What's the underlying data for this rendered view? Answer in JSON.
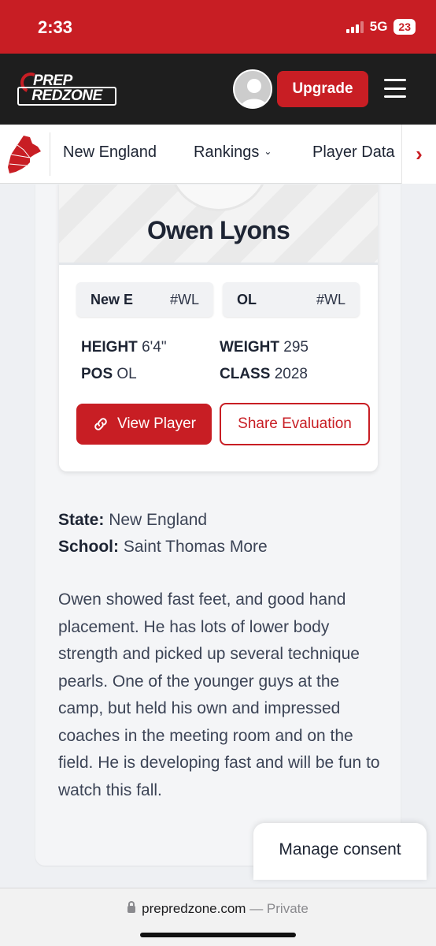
{
  "status": {
    "time": "2:33",
    "network": "5G",
    "battery": "23"
  },
  "header": {
    "logo_line1": "PREP",
    "logo_line2": "REDZONE",
    "upgrade_label": "Upgrade"
  },
  "subnav": {
    "items": [
      "New England",
      "Rankings",
      "Player Data"
    ],
    "next_icon": "chevron-right-icon"
  },
  "player": {
    "name": "Owen Lyons",
    "rank_region": {
      "label": "New E",
      "value": "#WL"
    },
    "rank_position": {
      "label": "OL",
      "value": "#WL"
    },
    "height_label": "HEIGHT",
    "height": "6'4\"",
    "weight_label": "WEIGHT",
    "weight": "295",
    "pos_label": "POS",
    "pos": "OL",
    "class_label": "CLASS",
    "class": "2028",
    "view_label": "View Player",
    "share_label": "Share Evaluation"
  },
  "details": {
    "state_label": "State:",
    "state": "New England",
    "school_label": "School:",
    "school": "Saint Thomas More",
    "evaluation": "Owen showed fast feet, and good hand placement. He has lots of lower body strength and picked up several technique pearls. One of the younger guys at the camp, but held his own and impressed coaches in the meeting room and on the field. He is developing fast and will be fun to watch this fall."
  },
  "consent": {
    "label": "Manage consent"
  },
  "browser": {
    "domain": "prepredzone.com",
    "mode": "— Private"
  },
  "colors": {
    "brand_red": "#c81e24",
    "header_dark": "#1e1e1e"
  }
}
